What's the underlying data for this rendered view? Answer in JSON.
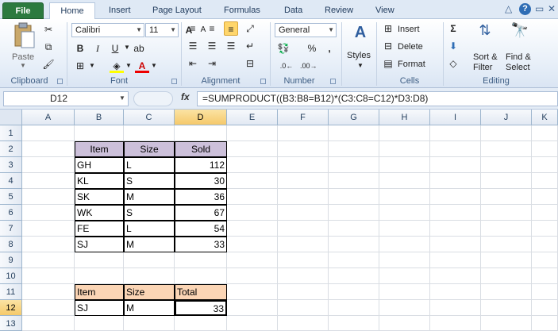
{
  "tabs": [
    "File",
    "Home",
    "Insert",
    "Page Layout",
    "Formulas",
    "Data",
    "Review",
    "View"
  ],
  "ribbon": {
    "clipboard": {
      "label": "Clipboard",
      "paste": "Paste"
    },
    "font": {
      "label": "Font",
      "font_name": "Calibri",
      "font_size": "11",
      "bold": "B",
      "italic": "I",
      "underline": "U",
      "grow": "A",
      "shrink": "A"
    },
    "alignment": {
      "label": "Alignment"
    },
    "number": {
      "label": "Number",
      "format": "General",
      "percent": "%",
      "comma": ","
    },
    "styles": {
      "label": "Styles"
    },
    "cells": {
      "label": "Cells",
      "insert": "Insert",
      "delete": "Delete",
      "format": "Format"
    },
    "editing": {
      "label": "Editing",
      "sort": "Sort &",
      "sort2": "Filter",
      "find": "Find &",
      "find2": "Select"
    }
  },
  "formula_bar": {
    "name_box": "D12",
    "fx": "fx",
    "formula": "=SUMPRODUCT((B3:B8=B12)*(C3:C8=C12)*D3:D8)"
  },
  "columns": [
    "A",
    "B",
    "C",
    "D",
    "E",
    "F",
    "G",
    "H",
    "I",
    "J",
    "K"
  ],
  "rows": [
    "1",
    "2",
    "3",
    "4",
    "5",
    "6",
    "7",
    "8",
    "9",
    "10",
    "11",
    "12",
    "13"
  ],
  "table": {
    "headers": [
      "Item",
      "Size",
      "Sold"
    ],
    "rows": [
      [
        "GH",
        "L",
        "112"
      ],
      [
        "KL",
        "S",
        "30"
      ],
      [
        "SK",
        "M",
        "36"
      ],
      [
        "WK",
        "S",
        "67"
      ],
      [
        "FE",
        "L",
        "54"
      ],
      [
        "SJ",
        "M",
        "33"
      ]
    ]
  },
  "lookup": {
    "headers": [
      "Item",
      "Size",
      "Total"
    ],
    "values": [
      "SJ",
      "M",
      "33"
    ]
  },
  "colors": {
    "file_tab": "#2c7a3f",
    "header_purple": "#ccc0da",
    "header_orange": "#fbd5b5",
    "active_header": "#f5c96a",
    "highlight_button": "#ffd66b"
  }
}
